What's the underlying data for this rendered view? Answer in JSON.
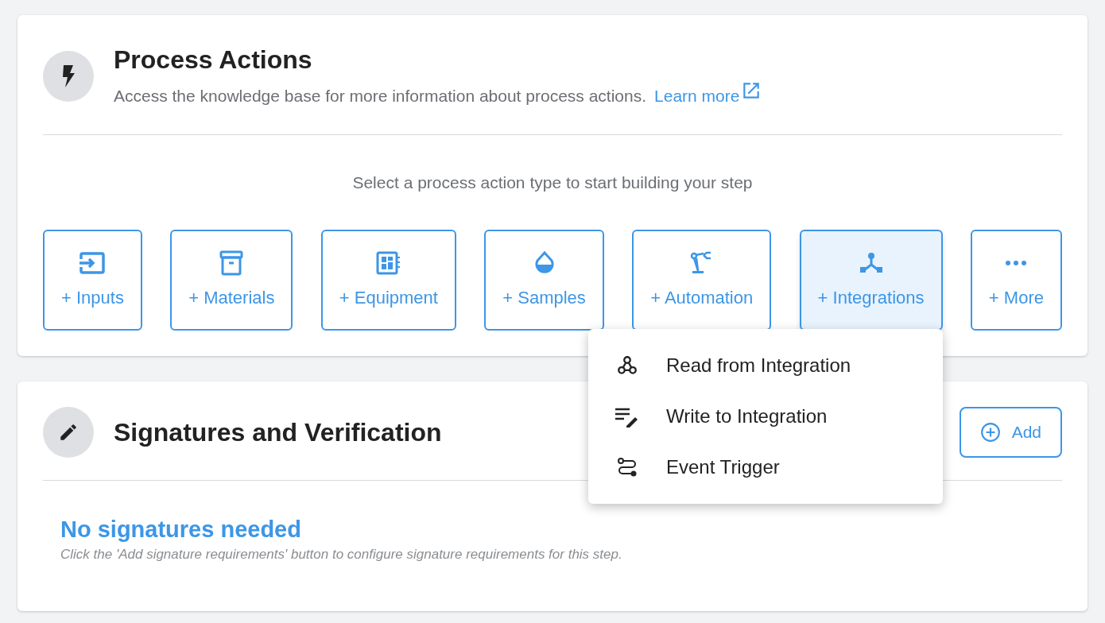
{
  "process_actions": {
    "title": "Process Actions",
    "description": "Access the knowledge base for more information about process actions.",
    "learn_more": "Learn more",
    "prompt": "Select a process action type to start building your step",
    "actions": [
      {
        "kind": "inputs",
        "label": "+ Inputs",
        "selected": false
      },
      {
        "kind": "materials",
        "label": "+ Materials",
        "selected": false
      },
      {
        "kind": "equipment",
        "label": "+ Equipment",
        "selected": false
      },
      {
        "kind": "samples",
        "label": "+ Samples",
        "selected": false
      },
      {
        "kind": "automation",
        "label": "+ Automation",
        "selected": false
      },
      {
        "kind": "integrations",
        "label": "+ Integrations",
        "selected": true
      },
      {
        "kind": "more",
        "label": "+ More",
        "selected": false
      }
    ]
  },
  "integrations_menu": {
    "items": [
      {
        "kind": "read",
        "label": "Read from Integration"
      },
      {
        "kind": "write",
        "label": "Write to Integration"
      },
      {
        "kind": "trigger",
        "label": "Event Trigger"
      }
    ]
  },
  "signatures": {
    "title": "Signatures and Verification",
    "add_button": "Add",
    "empty_title": "No signatures needed",
    "empty_hint": "Click the 'Add signature requirements' button to configure signature requirements for this step."
  }
}
